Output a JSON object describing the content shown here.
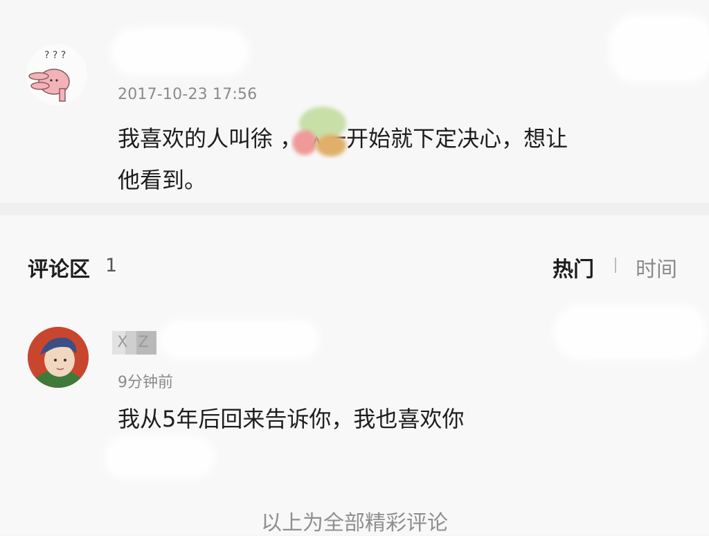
{
  "post": {
    "timestamp": "2017-10-23 17:56",
    "text": "我喜欢的人叫徐          ，从一开始就下定决心，想让\n他看到。",
    "avatar_icon": "pink-rabbit-avatar-icon",
    "avatar_caption": "? ? ?"
  },
  "comments_section": {
    "title": "评论区",
    "count": "1",
    "sort_hot": "热门",
    "sort_time": "时间"
  },
  "comment": {
    "username_partial": "X Z",
    "time": "9分钟前",
    "text": "我从5年后回来告诉你，我也喜欢你",
    "avatar_icon": "child-portrait-avatar-icon"
  },
  "footer": {
    "text": "以上为全部精彩评论"
  },
  "colors": {
    "background": "#f6f6f6",
    "text": "#1d1d1d",
    "muted": "#8a8a8a"
  }
}
